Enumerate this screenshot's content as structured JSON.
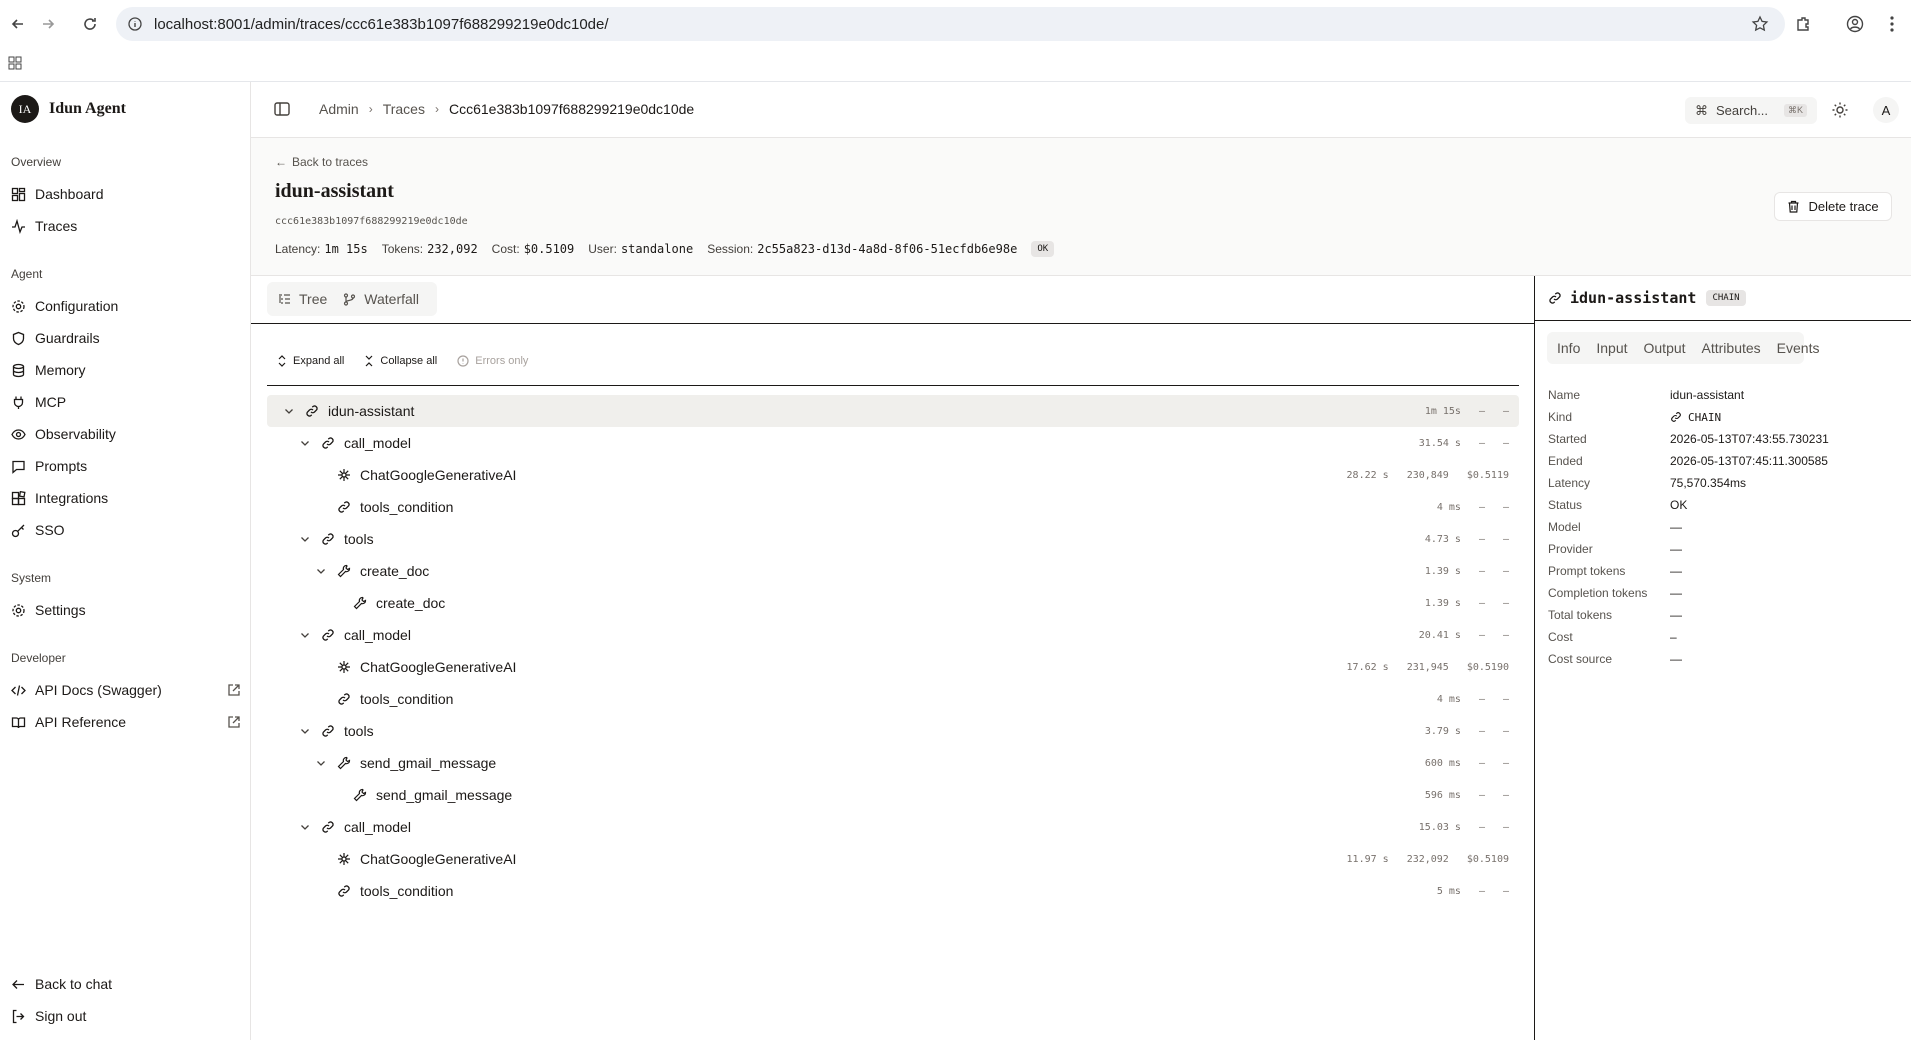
{
  "browser": {
    "url": "localhost:8001/admin/traces/ccc61e383b1097f688299219e0dc10de/"
  },
  "sidebar": {
    "brand_initials": "IA",
    "brand_name": "Idun Agent",
    "sections": {
      "overview": "Overview",
      "agent": "Agent",
      "system": "System",
      "developer": "Developer"
    },
    "items": {
      "dashboard": "Dashboard",
      "traces": "Traces",
      "configuration": "Configuration",
      "guardrails": "Guardrails",
      "memory": "Memory",
      "mcp": "MCP",
      "observability": "Observability",
      "prompts": "Prompts",
      "integrations": "Integrations",
      "sso": "SSO",
      "settings": "Settings",
      "api_docs": "API Docs (Swagger)",
      "api_reference": "API Reference",
      "back_to_chat": "Back to chat",
      "sign_out": "Sign out"
    }
  },
  "topbar": {
    "breadcrumb": [
      "Admin",
      "Traces",
      "Ccc61e383b1097f688299219e0dc10de"
    ],
    "search_label": "Search...",
    "search_kbd": "⌘K",
    "avatar": "A"
  },
  "header": {
    "back_label": "Back to traces",
    "title": "idun-assistant",
    "trace_id": "ccc61e383b1097f688299219e0dc10de",
    "latency_label": "Latency:",
    "latency": "1m 15s",
    "tokens_label": "Tokens:",
    "tokens": "232,092",
    "cost_label": "Cost:",
    "cost": "$0.5109",
    "user_label": "User:",
    "user": "standalone",
    "session_label": "Session:",
    "session": "2c55a823-d13d-4a8d-8f06-51ecfdb6e98e",
    "status": "OK",
    "delete_label": "Delete trace"
  },
  "view_tabs": [
    "Tree",
    "Waterfall"
  ],
  "tree_actions": {
    "expand": "Expand all",
    "collapse": "Collapse all",
    "errors": "Errors only"
  },
  "tree": [
    {
      "label": "idun-assistant",
      "depth": 0,
      "icon": "link-icon",
      "caret": true,
      "latency": "1m 15s",
      "tokens": "–",
      "cost": "–"
    },
    {
      "label": "call_model",
      "depth": 1,
      "icon": "link-icon",
      "caret": true,
      "latency": "31.54 s",
      "tokens": "–",
      "cost": "–"
    },
    {
      "label": "ChatGoogleGenerativeAI",
      "depth": 2,
      "icon": "sparkle-icon",
      "caret": false,
      "latency": "28.22 s",
      "tokens": "230,849",
      "cost": "$0.5119"
    },
    {
      "label": "tools_condition",
      "depth": 2,
      "icon": "link-icon",
      "caret": false,
      "latency": "4 ms",
      "tokens": "–",
      "cost": "–"
    },
    {
      "label": "tools",
      "depth": 1,
      "icon": "link-icon",
      "caret": true,
      "latency": "4.73 s",
      "tokens": "–",
      "cost": "–"
    },
    {
      "label": "create_doc",
      "depth": 2,
      "icon": "wrench-icon",
      "caret": true,
      "latency": "1.39 s",
      "tokens": "–",
      "cost": "–"
    },
    {
      "label": "create_doc",
      "depth": 3,
      "icon": "wrench-icon",
      "caret": false,
      "latency": "1.39 s",
      "tokens": "–",
      "cost": "–"
    },
    {
      "label": "call_model",
      "depth": 1,
      "icon": "link-icon",
      "caret": true,
      "latency": "20.41 s",
      "tokens": "–",
      "cost": "–"
    },
    {
      "label": "ChatGoogleGenerativeAI",
      "depth": 2,
      "icon": "sparkle-icon",
      "caret": false,
      "latency": "17.62 s",
      "tokens": "231,945",
      "cost": "$0.5190"
    },
    {
      "label": "tools_condition",
      "depth": 2,
      "icon": "link-icon",
      "caret": false,
      "latency": "4 ms",
      "tokens": "–",
      "cost": "–"
    },
    {
      "label": "tools",
      "depth": 1,
      "icon": "link-icon",
      "caret": true,
      "latency": "3.79 s",
      "tokens": "–",
      "cost": "–"
    },
    {
      "label": "send_gmail_message",
      "depth": 2,
      "icon": "wrench-icon",
      "caret": true,
      "latency": "600 ms",
      "tokens": "–",
      "cost": "–"
    },
    {
      "label": "send_gmail_message",
      "depth": 3,
      "icon": "wrench-icon",
      "caret": false,
      "latency": "596 ms",
      "tokens": "–",
      "cost": "–"
    },
    {
      "label": "call_model",
      "depth": 1,
      "icon": "link-icon",
      "caret": true,
      "latency": "15.03 s",
      "tokens": "–",
      "cost": "–"
    },
    {
      "label": "ChatGoogleGenerativeAI",
      "depth": 2,
      "icon": "sparkle-icon",
      "caret": false,
      "latency": "11.97 s",
      "tokens": "232,092",
      "cost": "$0.5109"
    },
    {
      "label": "tools_condition",
      "depth": 2,
      "icon": "link-icon",
      "caret": false,
      "latency": "5 ms",
      "tokens": "–",
      "cost": "–"
    }
  ],
  "details": {
    "title": "idun-assistant",
    "kind_badge": "CHAIN",
    "tabs": [
      "Info",
      "Input",
      "Output",
      "Attributes",
      "Events"
    ],
    "fields": [
      {
        "key": "Name",
        "value": "idun-assistant"
      },
      {
        "key": "Kind",
        "value": "CHAIN"
      },
      {
        "key": "Started",
        "value": "2026-05-13T07:43:55.730231"
      },
      {
        "key": "Ended",
        "value": "2026-05-13T07:45:11.300585"
      },
      {
        "key": "Latency",
        "value": "75,570.354ms"
      },
      {
        "key": "Status",
        "value": "OK"
      },
      {
        "key": "Model",
        "value": "—"
      },
      {
        "key": "Provider",
        "value": "—"
      },
      {
        "key": "Prompt tokens",
        "value": "—"
      },
      {
        "key": "Completion tokens",
        "value": "—"
      },
      {
        "key": "Total tokens",
        "value": "—"
      },
      {
        "key": "Cost",
        "value": "–"
      },
      {
        "key": "Cost source",
        "value": "—"
      }
    ]
  }
}
